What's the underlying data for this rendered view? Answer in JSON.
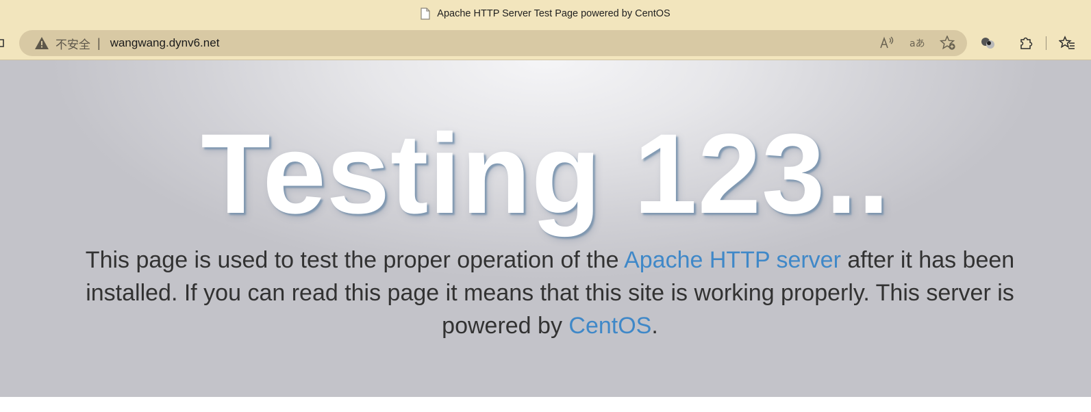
{
  "browser": {
    "tab_title": "Apache HTTP Server Test Page powered by CentOS",
    "security_label": "不安全",
    "separator": "|",
    "url": "wangwang.dynv6.net",
    "icons": [
      "document-icon",
      "warning-icon",
      "read-aloud-icon",
      "translate-icon",
      "add-favorite-icon",
      "extension-orb-icon",
      "extensions-puzzle-icon",
      "favorites-icon"
    ],
    "theme_color": "#f2e5bd",
    "omnibox_color": "#d8c9a4"
  },
  "page": {
    "heading": "Testing 123..",
    "paragraph": {
      "part1": "This page is used to test the proper operation of the ",
      "link1": "Apache HTTP server",
      "part2": " after it has been installed. If you can read this page it means that this site is working properly. This server is powered by ",
      "link2": "CentOS",
      "part3": "."
    },
    "link_color": "#3f88c8"
  }
}
